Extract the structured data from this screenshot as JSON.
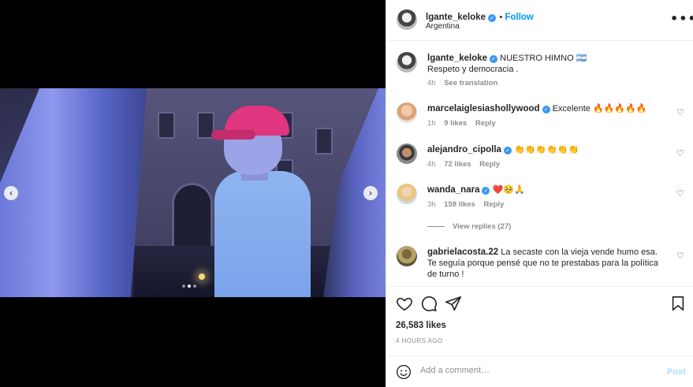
{
  "post": {
    "username": "lgante_keloke",
    "follow_label": "Follow",
    "location": "Argentina",
    "more_label": "•••"
  },
  "carousel": {
    "prev_label": "‹",
    "next_label": "›",
    "slide_count": 3,
    "active_slide": 2
  },
  "caption": {
    "username": "lgante_keloke",
    "text_line1": "NUESTRO HIMNO 🇦🇷",
    "text_line2": "Respeto y democracia .",
    "time": "4h",
    "see_translation": "See translation"
  },
  "comments": [
    {
      "username": "marcelaiglesiashollywood",
      "text": "Excelente 🔥🔥🔥🔥🔥",
      "time": "1h",
      "likes": "9 likes",
      "reply": "Reply"
    },
    {
      "username": "alejandro_cipolla",
      "text": "👏👏👏👏👏👏",
      "time": "4h",
      "likes": "72 likes",
      "reply": "Reply"
    },
    {
      "username": "wanda_nara",
      "text": "❤️🥺🙏",
      "time": "3h",
      "likes": "159 likes",
      "reply": "Reply",
      "view_replies": "View replies (27)"
    },
    {
      "username": "gabrielacosta.22",
      "text": "La secaste con la vieja vende humo esa. Te seguía porque pensé que no te prestabas para la política de turno !"
    }
  ],
  "footer": {
    "likes": "26,583 likes",
    "time": "4 HOURS AGO",
    "comment_placeholder": "Add a comment…",
    "post_label": "Post"
  },
  "colors": {
    "accent": "#0095f6",
    "verified": "#3897f0",
    "muted": "#8e8e8e"
  }
}
